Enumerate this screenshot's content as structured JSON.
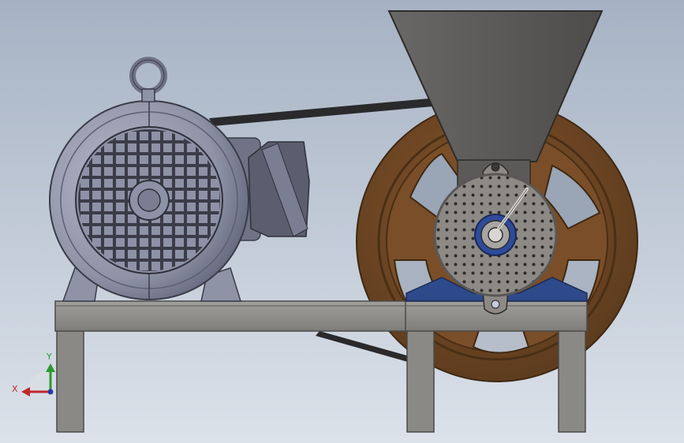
{
  "viewport": {
    "background_top": "#a6b2c4",
    "background_bottom": "#dce2ea"
  },
  "triad": {
    "x_label": "X",
    "y_label": "Y",
    "x_color": "#c0282a",
    "y_color": "#2a9a30",
    "z_color": "#2a3aa8"
  },
  "model": {
    "parts": [
      "electric-motor",
      "drive-belt",
      "flywheel-pulley",
      "hopper",
      "grinding-plate",
      "base-frame"
    ],
    "colors": {
      "motor": "#8f93a6",
      "frame": "#8e8d8a",
      "flywheel": "#6b4524",
      "hopper": "#5a5856",
      "plate": "#8d8a86",
      "bracket": "#2e4a8a"
    }
  }
}
